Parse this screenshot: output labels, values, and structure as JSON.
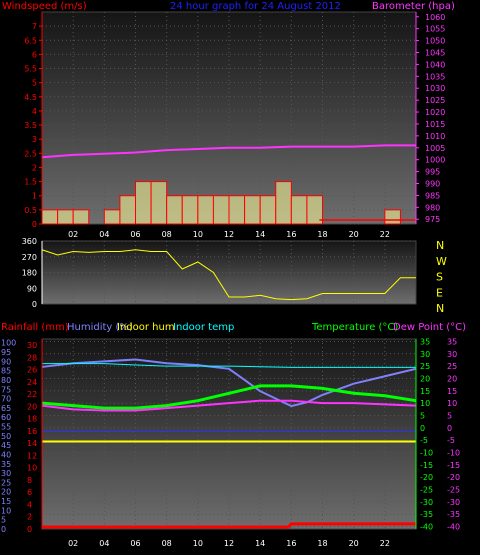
{
  "colors": {
    "windspeed": "#ff0000",
    "title": "#2020ff",
    "barometer": "#ff33ff",
    "gust_fill": "#ffff99",
    "direction": "#ffff00",
    "rainfall": "#ff0000",
    "humidity": "#8080ff",
    "indoor_hum": "#ffff00",
    "indoor_temp": "#00ffff",
    "temperature": "#00ff00",
    "dew_point": "#ff33ff",
    "axis_text": "#ffffff"
  },
  "chart_data": [
    {
      "type": "bar",
      "title": "24 hour graph for 24 August 2012",
      "ylabel": "Windspeed (m/s)",
      "y2label": "Barometer (hpa)",
      "x_ticks": [
        "02",
        "04",
        "06",
        "08",
        "10",
        "12",
        "14",
        "16",
        "18",
        "20",
        "22"
      ],
      "y_ticks": [
        "0",
        "0.5",
        "1",
        "1.5",
        "2",
        "2.5",
        "3",
        "3.5",
        "4",
        "4.5",
        "5",
        "5.5",
        "6",
        "6.5",
        "7"
      ],
      "y2_ticks": [
        "975",
        "980",
        "985",
        "990",
        "995",
        "1000",
        "1005",
        "1010",
        "1015",
        "1020",
        "1025",
        "1030",
        "1035",
        "1040",
        "1045",
        "1050",
        "1055",
        "1060"
      ],
      "ylim": [
        0,
        7.5
      ],
      "y2lim": [
        973,
        1062
      ],
      "grid": true,
      "series": [
        {
          "name": "Windspeed (m/s)",
          "x": [
            0.5,
            1.5,
            2.5,
            3.5,
            4.5,
            5.5,
            6.5,
            7.5,
            8.5,
            9.5,
            10.5,
            11.5,
            12.5,
            13.5,
            14.5,
            15.5,
            16.5,
            17.5,
            18.5,
            19.5,
            20.5,
            21.5,
            22.5,
            23.5
          ],
          "values": [
            0.5,
            0.5,
            0.5,
            0,
            0.5,
            1,
            1.5,
            1.5,
            1,
            1,
            1,
            1,
            1,
            1,
            1,
            1.5,
            1,
            1,
            0,
            0,
            0,
            0,
            0.5,
            0
          ]
        },
        {
          "name": "Barometer (hpa)",
          "x": [
            0,
            2,
            4,
            6,
            8,
            10,
            12,
            14,
            16,
            18,
            20,
            22,
            24
          ],
          "values": [
            1001,
            1002,
            1002.5,
            1003,
            1004,
            1004.5,
            1005,
            1005,
            1005.5,
            1005.5,
            1005.5,
            1006,
            1006
          ]
        }
      ]
    },
    {
      "type": "line",
      "yticks": [
        "0",
        "90",
        "180",
        "270",
        "360"
      ],
      "ylim": [
        0,
        360
      ],
      "compass": [
        "N",
        "W",
        "S",
        "E",
        "N"
      ],
      "grid": true,
      "series": [
        {
          "name": "Wind direction",
          "x": [
            0,
            1,
            2,
            3,
            4,
            5,
            6,
            7,
            8,
            9,
            10,
            11,
            12,
            13,
            14,
            15,
            16,
            17,
            18,
            19,
            20,
            21,
            22,
            23,
            24
          ],
          "values": [
            310,
            280,
            300,
            295,
            300,
            300,
            310,
            300,
            300,
            200,
            240,
            180,
            40,
            40,
            50,
            30,
            25,
            30,
            60,
            60,
            60,
            60,
            60,
            150,
            150
          ]
        }
      ]
    },
    {
      "type": "line",
      "left_labels": [
        "Rainfall (mm)",
        "Humidity (%)",
        "Indoor hum",
        "Indoor temp"
      ],
      "right_labels": [
        "Temperature (°C)",
        "Dew Point (°C)"
      ],
      "humidity_ticks": [
        "0",
        "5",
        "10",
        "15",
        "20",
        "25",
        "30",
        "35",
        "40",
        "45",
        "50",
        "55",
        "60",
        "65",
        "70",
        "75",
        "80",
        "85",
        "90",
        "95",
        "100"
      ],
      "rain_ticks": [
        "0",
        "2",
        "4",
        "6",
        "8",
        "10",
        "12",
        "14",
        "16",
        "18",
        "20",
        "22",
        "24",
        "26",
        "28",
        "30"
      ],
      "temp_ticks_right1": [
        "-40",
        "-35",
        "-30",
        "-25",
        "-20",
        "-15",
        "-10",
        "-5",
        "0",
        "5",
        "10",
        "15",
        "20",
        "25",
        "30",
        "35"
      ],
      "temp_ticks_right2": [
        "-40",
        "-35",
        "-30",
        "-25",
        "-20",
        "-15",
        "-10",
        "-5",
        "0",
        "5",
        "10",
        "15",
        "20",
        "25",
        "30",
        "35"
      ],
      "temp_ylim": [
        -41,
        36
      ],
      "humidity_ylim": [
        0,
        102
      ],
      "x_ticks": [
        "02",
        "04",
        "06",
        "08",
        "10",
        "12",
        "14",
        "16",
        "18",
        "20",
        "22"
      ],
      "grid": true,
      "series": [
        {
          "name": "Humidity (%)",
          "x": [
            0,
            2,
            4,
            6,
            8,
            10,
            12,
            13,
            14,
            15,
            16,
            17,
            18,
            19,
            20,
            21,
            22,
            23,
            24
          ],
          "values": [
            87,
            89,
            90,
            91,
            89,
            88,
            86,
            80,
            74,
            70,
            66,
            68,
            72,
            75,
            78,
            80,
            82,
            84,
            86
          ]
        },
        {
          "name": "Indoor temp",
          "x": [
            0,
            4,
            8,
            12,
            16,
            20,
            24
          ],
          "values": [
            26,
            26,
            25,
            25,
            24.5,
            24.5,
            24.5
          ]
        },
        {
          "name": "Temperature (°C)",
          "x": [
            0,
            2,
            4,
            6,
            8,
            10,
            12,
            14,
            16,
            18,
            20,
            22,
            24
          ],
          "values": [
            10,
            9,
            8,
            8,
            9,
            11,
            14,
            17,
            17,
            16,
            14,
            13,
            11
          ]
        },
        {
          "name": "Dew Point (°C)",
          "x": [
            0,
            2,
            4,
            6,
            8,
            10,
            12,
            14,
            16,
            18,
            20,
            22,
            24
          ],
          "values": [
            9,
            7.5,
            7,
            7,
            8,
            9,
            10,
            11,
            11,
            10,
            10,
            9.5,
            9
          ]
        },
        {
          "name": "Indoor hum",
          "x": [
            0,
            24
          ],
          "values": [
            47,
            47
          ]
        },
        {
          "name": "Rainfall (mm)",
          "x": [
            0,
            15.8,
            16,
            24
          ],
          "values": [
            0,
            0,
            0.5,
            0.5
          ]
        }
      ]
    }
  ]
}
